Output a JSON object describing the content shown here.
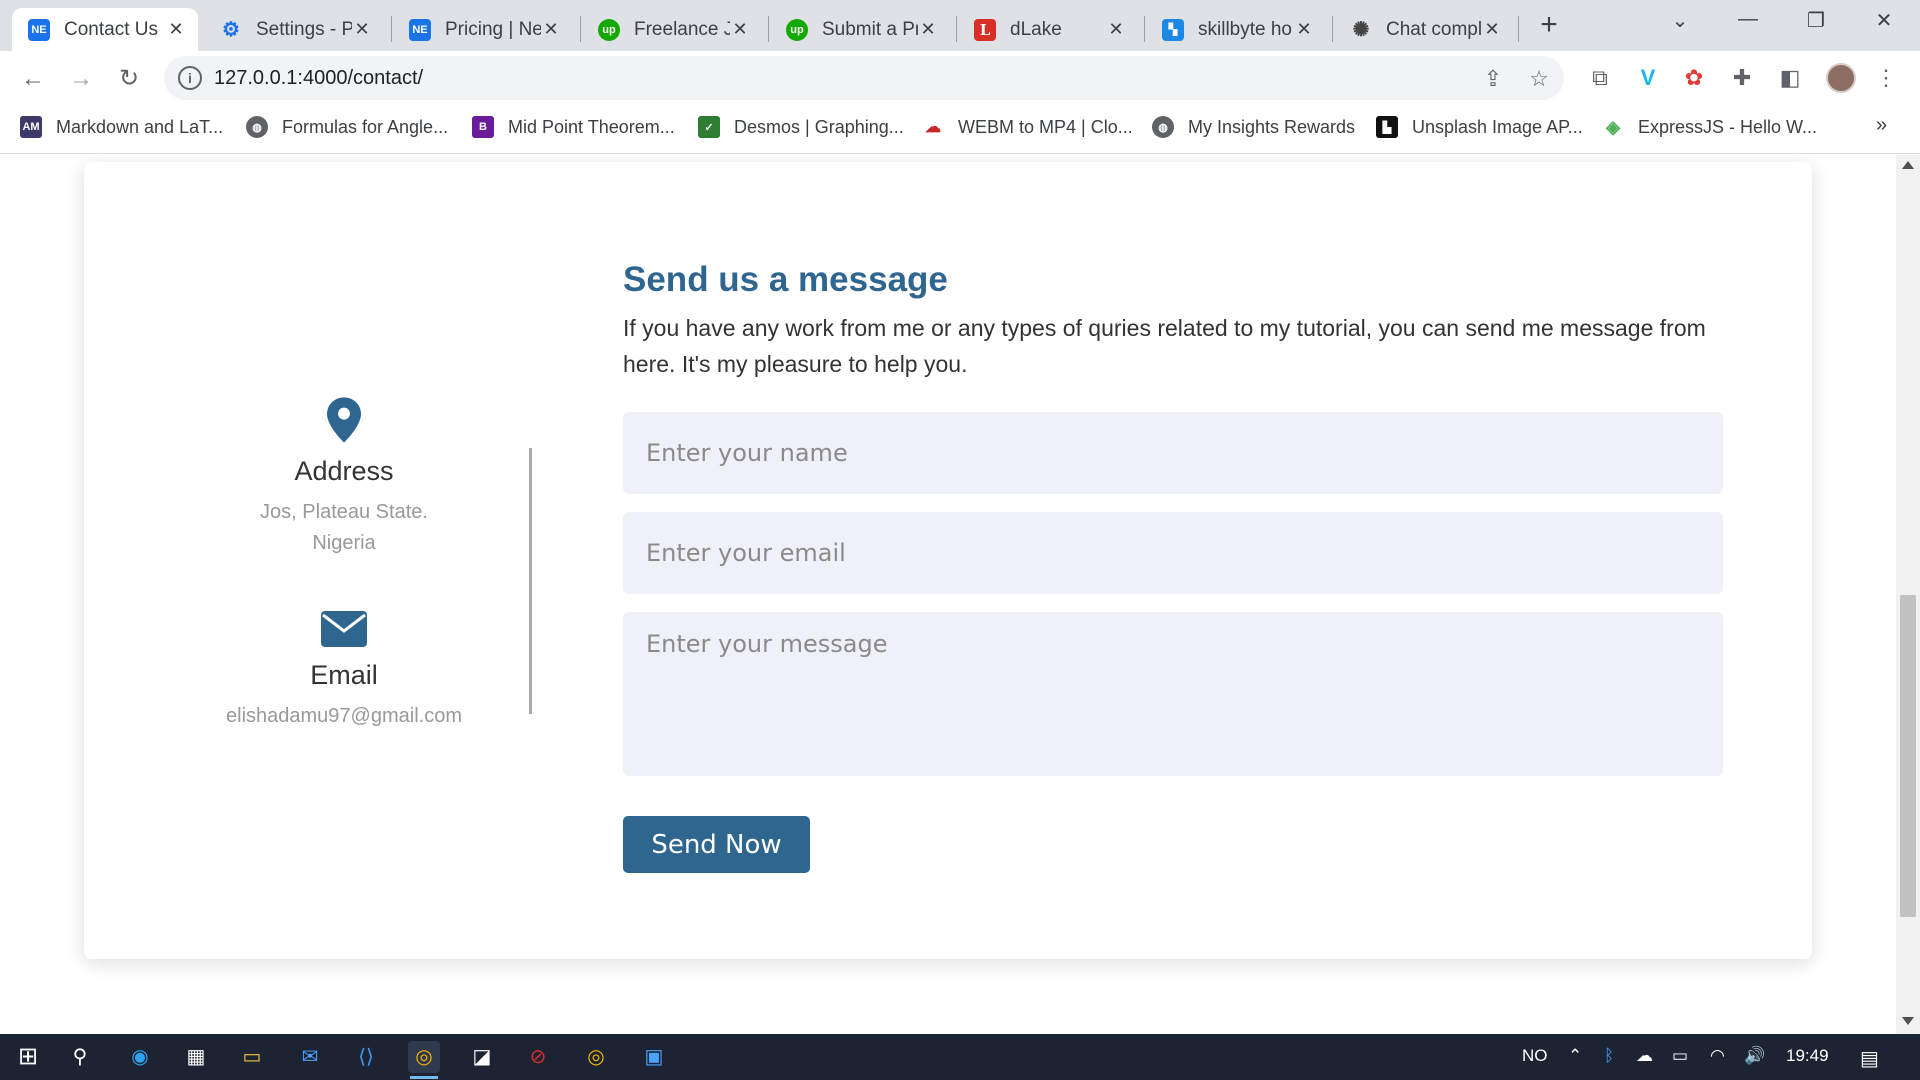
{
  "browser": {
    "tabs": [
      {
        "title": "Contact Us",
        "favicon": "NE",
        "color": "#1a73e8",
        "active": true
      },
      {
        "title": "Settings - P",
        "favicon": "gear-icon",
        "color": "#1a73e8",
        "active": false
      },
      {
        "title": "Pricing | Ne",
        "favicon": "NE",
        "color": "#1a73e8",
        "active": false
      },
      {
        "title": "Freelance Jo",
        "favicon": "up",
        "color": "#14a800",
        "active": false
      },
      {
        "title": "Submit a Pr",
        "favicon": "up",
        "color": "#14a800",
        "active": false
      },
      {
        "title": "dLake",
        "favicon": "L",
        "color": "#d93025",
        "active": false
      },
      {
        "title": "skillbyte ho",
        "favicon": "sb",
        "color": "#1e88e5",
        "active": false
      },
      {
        "title": "Chat compl",
        "favicon": "openai-icon",
        "color": "#444444",
        "active": false
      }
    ],
    "url": "127.0.0.1:4000/contact/",
    "bookmarks": [
      {
        "label": "Markdown and LaT...",
        "icon": "AM",
        "color": "#3c3a6b"
      },
      {
        "label": "Formulas for Angle...",
        "icon": "globe",
        "color": "#5f6368"
      },
      {
        "label": "Mid Point Theorem...",
        "icon": "B",
        "color": "#6a1b9a"
      },
      {
        "label": "Desmos | Graphing...",
        "icon": "desmos",
        "color": "#2e7d32"
      },
      {
        "label": "WEBM to MP4 | Clo...",
        "icon": "cloud",
        "color": "#c62828"
      },
      {
        "label": "My Insights Rewards",
        "icon": "globe",
        "color": "#5f6368"
      },
      {
        "label": "Unsplash Image AP...",
        "icon": "unsplash",
        "color": "#111111"
      },
      {
        "label": "ExpressJS - Hello W...",
        "icon": "express",
        "color": "#4caf50"
      }
    ]
  },
  "page": {
    "accent": "#2f6690",
    "address": {
      "title": "Address",
      "line1": "Jos, Plateau State.",
      "line2": "Nigeria"
    },
    "email": {
      "title": "Email",
      "value": "elishadamu97@gmail.com"
    },
    "form": {
      "heading": "Send us a message",
      "description": "If you have any work from me or any types of quries related to my tutorial, you can send me message from here. It's my pleasure to help you.",
      "name_placeholder": "Enter your name",
      "email_placeholder": "Enter your email",
      "message_placeholder": "Enter your message",
      "submit_label": "Send Now"
    }
  },
  "taskbar": {
    "language": "NO",
    "time": "19:49"
  }
}
